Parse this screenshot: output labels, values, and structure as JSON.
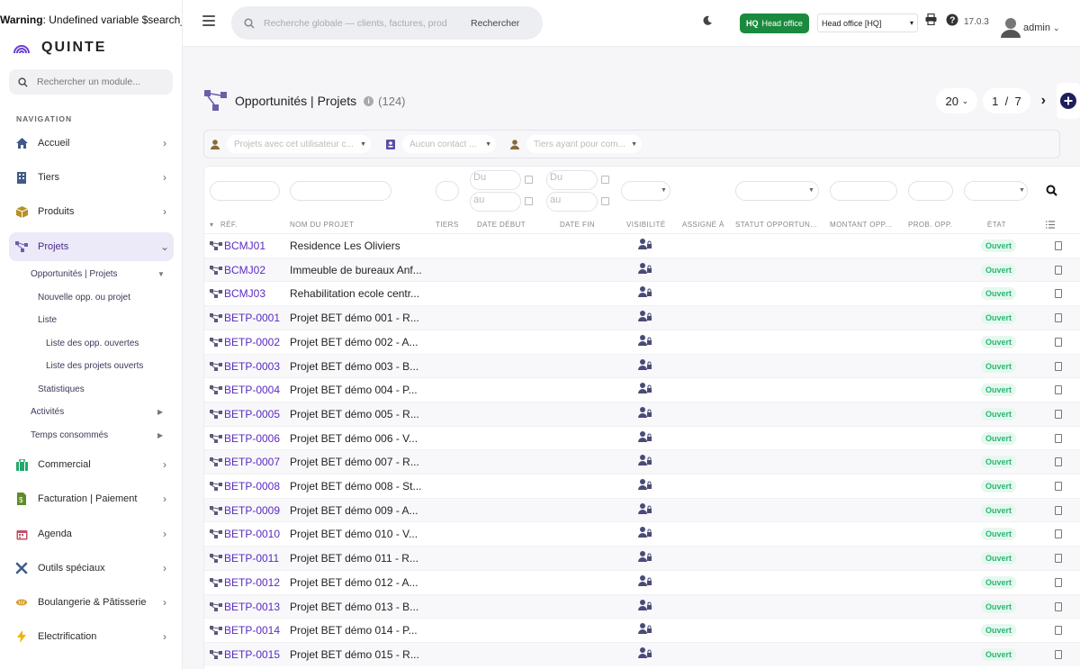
{
  "warning": {
    "label": "Warning",
    "text": ": Undefined variable $search_cat"
  },
  "app": {
    "name": "QUINTE"
  },
  "sidebar": {
    "search_placeholder": "Rechercher un module...",
    "nav_title": "NAVIGATION",
    "items": [
      {
        "label": "Accueil",
        "icon": "home-icon"
      },
      {
        "label": "Tiers",
        "icon": "building-icon"
      },
      {
        "label": "Produits",
        "icon": "box-icon"
      },
      {
        "label": "Projets",
        "icon": "project-icon"
      },
      {
        "label": "Commercial",
        "icon": "briefcase-icon"
      },
      {
        "label": "Facturation | Paiement",
        "icon": "invoice-icon"
      },
      {
        "label": "Agenda",
        "icon": "calendar-icon"
      },
      {
        "label": "Outils spéciaux",
        "icon": "tools-icon"
      },
      {
        "label": "Boulangerie & Pâtisserie",
        "icon": "bread-icon"
      },
      {
        "label": "Electrification",
        "icon": "lightning-icon"
      }
    ],
    "sub_items": [
      {
        "label": "Opportunités | Projets"
      },
      {
        "label": "Nouvelle opp. ou projet"
      },
      {
        "label": "Liste"
      },
      {
        "label": "Liste des opp. ouvertes"
      },
      {
        "label": "Liste des projets ouverts"
      },
      {
        "label": "Statistiques"
      },
      {
        "label": "Activités"
      },
      {
        "label": "Temps consommés"
      }
    ]
  },
  "topbar": {
    "search_placeholder": "Recherche globale — clients, factures, prod",
    "search_button": "Rechercher",
    "hq_badge_code": "HQ",
    "hq_badge_label": "Head office",
    "office_select": "Head office [HQ]",
    "version": "17.0.3",
    "user": "admin"
  },
  "page": {
    "title": "Opportunités | Projets",
    "count": "(124)",
    "per_page": "20",
    "page_current": "1",
    "page_sep": "/",
    "page_total": "7"
  },
  "filters": {
    "user_projects": "Projets avec cet utilisateur c...",
    "contact": "Aucun contact ...",
    "tiers": "Tiers ayant pour com..."
  },
  "date_filters": {
    "du": "Du",
    "au": "au"
  },
  "table": {
    "columns": [
      "RÉF.",
      "NOM DU PROJET",
      "TIERS",
      "DATE DÉBUT",
      "DATE FIN",
      "VISIBILITÉ",
      "ASSIGNÉ À",
      "STATUT OPPORTUN...",
      "MONTANT OPP...",
      "PROB. OPP.",
      "ÉTAT"
    ],
    "rows": [
      {
        "ref": "BCMJ01",
        "name": "Residence Les Oliviers",
        "etat": "Ouvert"
      },
      {
        "ref": "BCMJ02",
        "name": "Immeuble de bureaux Anf...",
        "etat": "Ouvert"
      },
      {
        "ref": "BCMJ03",
        "name": "Rehabilitation ecole centr...",
        "etat": "Ouvert"
      },
      {
        "ref": "BETP-0001",
        "name": "Projet BET démo 001 - R...",
        "etat": "Ouvert"
      },
      {
        "ref": "BETP-0002",
        "name": "Projet BET démo 002 - A...",
        "etat": "Ouvert"
      },
      {
        "ref": "BETP-0003",
        "name": "Projet BET démo 003 - B...",
        "etat": "Ouvert"
      },
      {
        "ref": "BETP-0004",
        "name": "Projet BET démo 004 - P...",
        "etat": "Ouvert"
      },
      {
        "ref": "BETP-0005",
        "name": "Projet BET démo 005 - R...",
        "etat": "Ouvert"
      },
      {
        "ref": "BETP-0006",
        "name": "Projet BET démo 006 - V...",
        "etat": "Ouvert"
      },
      {
        "ref": "BETP-0007",
        "name": "Projet BET démo 007 - R...",
        "etat": "Ouvert"
      },
      {
        "ref": "BETP-0008",
        "name": "Projet BET démo 008 - St...",
        "etat": "Ouvert"
      },
      {
        "ref": "BETP-0009",
        "name": "Projet BET démo 009 - A...",
        "etat": "Ouvert"
      },
      {
        "ref": "BETP-0010",
        "name": "Projet BET démo 010 - V...",
        "etat": "Ouvert"
      },
      {
        "ref": "BETP-0011",
        "name": "Projet BET démo 011 - R...",
        "etat": "Ouvert"
      },
      {
        "ref": "BETP-0012",
        "name": "Projet BET démo 012 - A...",
        "etat": "Ouvert"
      },
      {
        "ref": "BETP-0013",
        "name": "Projet BET démo 013 - B...",
        "etat": "Ouvert"
      },
      {
        "ref": "BETP-0014",
        "name": "Projet BET démo 014 - P...",
        "etat": "Ouvert"
      },
      {
        "ref": "BETP-0015",
        "name": "Projet BET démo 015 - R...",
        "etat": "Ouvert"
      }
    ]
  },
  "colors": {
    "accent": "#5a2bc0",
    "hq_green": "#1c8a3e",
    "status_green": "#2ab772",
    "nav_active_bg": "#ece9f8"
  }
}
